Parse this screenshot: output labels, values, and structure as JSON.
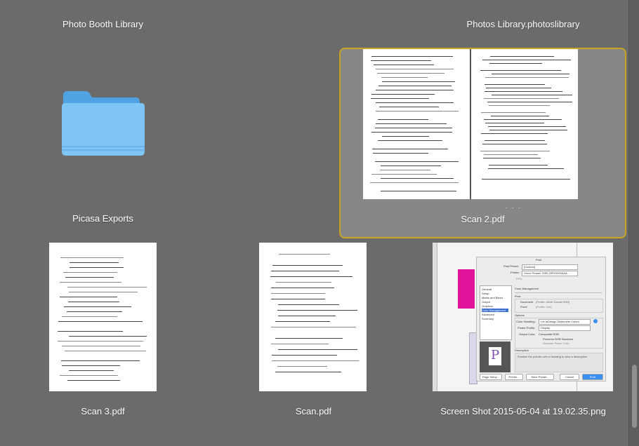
{
  "items": [
    {
      "name": "Photo Booth Library"
    },
    {
      "name": "Photos Library.photoslibrary"
    },
    {
      "name": "Picasa Exports"
    },
    {
      "name": "Scan 2.pdf"
    },
    {
      "name": "Scan 3.pdf"
    },
    {
      "name": "Scan.pdf"
    },
    {
      "name": "Screen Shot 2015-05-04 at 19.02.35.png"
    }
  ],
  "print_dialog": {
    "title": "Print",
    "print_preset_label": "Print Preset:",
    "print_preset_value": "[Custom]",
    "printer_label": "Printer:",
    "printer_value": "Xerox Phaser 3250 (XRX0000AAA...",
    "ppd_label": "PPD:",
    "sidebar": [
      "General",
      "Setup",
      "Marks and Bleed",
      "Output",
      "Graphics",
      "Color Management",
      "Advanced",
      "Summary"
    ],
    "section_title": "Color Management",
    "print_group": "Print",
    "document_option": "Document",
    "document_profile": "(Profile: Wide Gamut RGB)",
    "proof_option": "Proof",
    "proof_profile": "(Profile: N/A)",
    "options_group": "Options",
    "color_handling_label": "Color Handling:",
    "color_handling_value": "Let InDesign Determine Colors",
    "printer_profile_label": "Printer Profile:",
    "printer_profile_value": "Display",
    "output_color_label": "Output Color:",
    "output_color_value": "Composite RGB",
    "preserve_label": "Preserve RGB Numbers",
    "simulate_label": "Simulate Paper Color",
    "description_group": "Description",
    "description_text": "Position the pointer over a heading to view a description.",
    "preview_letter": "P",
    "buttons": [
      "Page Setup...",
      "Printer...",
      "Save Preset...",
      "Cancel",
      "Print"
    ]
  },
  "colors": {
    "background": "#6b6b6b",
    "selection_border": "#c9a227",
    "folder": "#6cb8f0",
    "magenta": "#e0139a",
    "print_button": "#3a8ff0"
  }
}
